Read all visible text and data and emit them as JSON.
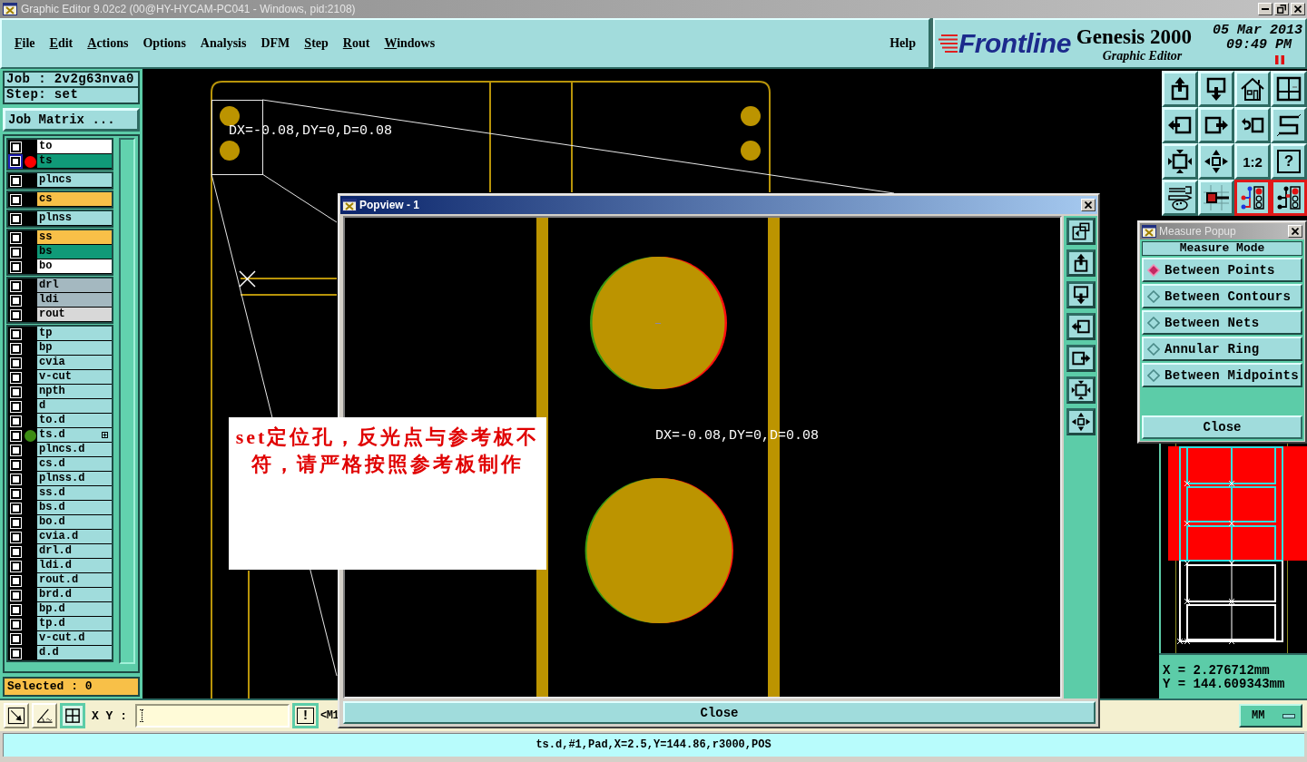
{
  "window": {
    "title": "Graphic Editor 9.02c2 (00@HY-HYCAM-PC041 - Windows, pid:2108)"
  },
  "menu": [
    {
      "label": "File",
      "underlined": true
    },
    {
      "label": "Edit",
      "underlined": true
    },
    {
      "label": "Actions",
      "underlined": true
    },
    {
      "label": "Options",
      "underlined": false
    },
    {
      "label": "Analysis",
      "underlined": false
    },
    {
      "label": "DFM",
      "underlined": false
    },
    {
      "label": "Step",
      "underlined": true
    },
    {
      "label": "Rout",
      "underlined": true
    },
    {
      "label": "Windows",
      "underlined": true
    },
    {
      "label": "Help",
      "underlined": false
    }
  ],
  "brand": {
    "logo": "Frontline",
    "product": "Genesis 2000",
    "subtitle": "Graphic Editor",
    "date": "05 Mar 2013",
    "time": "09:49 PM"
  },
  "job_panel": {
    "job": "Job : 2v2g63nva0",
    "step": "Step: set",
    "matrix_button": "Job Matrix ...",
    "layer_groups": [
      [
        {
          "name": "to",
          "color": "#ffffff",
          "work": false,
          "flag": false
        },
        {
          "name": "ts",
          "color": "#109a78",
          "work": true,
          "flag": false,
          "dot": {
            "color": "#ff0000"
          }
        }
      ],
      [
        {
          "name": "plncs",
          "color": "#a0dcdc",
          "work": false,
          "flag": false
        }
      ],
      [
        {
          "name": "cs",
          "color": "#f8c048",
          "work": false,
          "flag": false
        }
      ],
      [
        {
          "name": "plnss",
          "color": "#a0dcdc",
          "work": false,
          "flag": false
        }
      ],
      [
        {
          "name": "ss",
          "color": "#f8c048",
          "work": false,
          "flag": false
        },
        {
          "name": "bs",
          "color": "#109a78",
          "work": false,
          "flag": false
        },
        {
          "name": "bo",
          "color": "#ffffff",
          "work": false,
          "flag": false
        }
      ],
      [
        {
          "name": "drl",
          "color": "#a4b8c0",
          "work": false,
          "flag": false
        },
        {
          "name": "ldi",
          "color": "#a4b8c0",
          "work": false,
          "flag": false
        },
        {
          "name": "rout",
          "color": "#d8d8d8",
          "work": false,
          "flag": false
        }
      ],
      [
        {
          "name": "tp",
          "color": "#a0dcdc",
          "work": false,
          "flag": false
        },
        {
          "name": "bp",
          "color": "#a0dcdc",
          "work": false,
          "flag": false
        },
        {
          "name": "cvia",
          "color": "#a0dcdc",
          "work": false,
          "flag": false
        },
        {
          "name": "v-cut",
          "color": "#a0dcdc",
          "work": false,
          "flag": false
        },
        {
          "name": "npth",
          "color": "#a0dcdc",
          "work": false,
          "flag": false
        },
        {
          "name": "d",
          "color": "#a0dcdc",
          "work": false,
          "flag": false
        },
        {
          "name": "to.d",
          "color": "#a0dcdc",
          "work": false,
          "flag": false
        },
        {
          "name": "ts.d",
          "color": "#a0dcdc",
          "work": false,
          "flag": true,
          "dot": {
            "color": "#3c8c14"
          }
        },
        {
          "name": "plncs.d",
          "color": "#a0dcdc",
          "work": false,
          "flag": false
        },
        {
          "name": "cs.d",
          "color": "#a0dcdc",
          "work": false,
          "flag": false
        },
        {
          "name": "plnss.d",
          "color": "#a0dcdc",
          "work": false,
          "flag": false
        },
        {
          "name": "ss.d",
          "color": "#a0dcdc",
          "work": false,
          "flag": false
        },
        {
          "name": "bs.d",
          "color": "#a0dcdc",
          "work": false,
          "flag": false
        },
        {
          "name": "bo.d",
          "color": "#a0dcdc",
          "work": false,
          "flag": false
        },
        {
          "name": "cvia.d",
          "color": "#a0dcdc",
          "work": false,
          "flag": false
        },
        {
          "name": "drl.d",
          "color": "#a0dcdc",
          "work": false,
          "flag": false
        },
        {
          "name": "ldi.d",
          "color": "#a0dcdc",
          "work": false,
          "flag": false
        },
        {
          "name": "rout.d",
          "color": "#a0dcdc",
          "work": false,
          "flag": false
        },
        {
          "name": "brd.d",
          "color": "#a0dcdc",
          "work": false,
          "flag": false
        },
        {
          "name": "bp.d",
          "color": "#a0dcdc",
          "work": false,
          "flag": false
        },
        {
          "name": "tp.d",
          "color": "#a0dcdc",
          "work": false,
          "flag": false
        },
        {
          "name": "v-cut.d",
          "color": "#a0dcdc",
          "work": false,
          "flag": false
        },
        {
          "name": "d.d",
          "color": "#a0dcdc",
          "work": false,
          "flag": false
        }
      ]
    ],
    "selected": "Selected : 0"
  },
  "canvas": {
    "readout": "DX=-0.08,DY=0,D=0.08"
  },
  "view_toolbar": [
    {
      "on": false
    },
    {
      "on": false
    },
    {
      "on": false
    },
    {
      "on": false
    },
    {
      "on": false
    },
    {
      "on": false
    },
    {
      "on": false
    },
    {
      "on": false
    },
    {
      "on": false
    },
    {
      "on": false
    },
    {
      "label": "1:2",
      "on": false
    },
    {
      "label": "?",
      "on": false
    },
    {
      "on": false
    },
    {
      "on": false
    },
    {
      "on": true
    },
    {
      "on": true
    }
  ],
  "popview": {
    "title": "Popview - 1",
    "readout": "DX=-0.08,DY=0,D=0.08",
    "close": "Close"
  },
  "annotation": {
    "text": "set定位孔，反光点与参考板不符，请严格按照参考板制作"
  },
  "measure_popup": {
    "title": "Measure Popup",
    "heading": "Measure Mode",
    "modes": [
      {
        "label": "Between Points",
        "selected": true
      },
      {
        "label": "Between Contours",
        "selected": false
      },
      {
        "label": "Between Nets",
        "selected": false
      },
      {
        "label": "Annular Ring",
        "selected": false
      },
      {
        "label": "Between Midpoints",
        "selected": false
      }
    ],
    "close": "Close"
  },
  "cursor": {
    "x": "X = 2.276712mm",
    "y": "Y = 144.609343mm"
  },
  "bottom_toolbar": {
    "tools": [
      {
        "on": false
      },
      {
        "on": false
      },
      {
        "on": true
      }
    ],
    "xy_label": "X Y :",
    "exec_label": "!",
    "mode_text": "<M1",
    "units": "MM"
  },
  "status_bar": {
    "text": "ts.d,#1,Pad,X=2.5,Y=144.86,r3000,POS"
  }
}
